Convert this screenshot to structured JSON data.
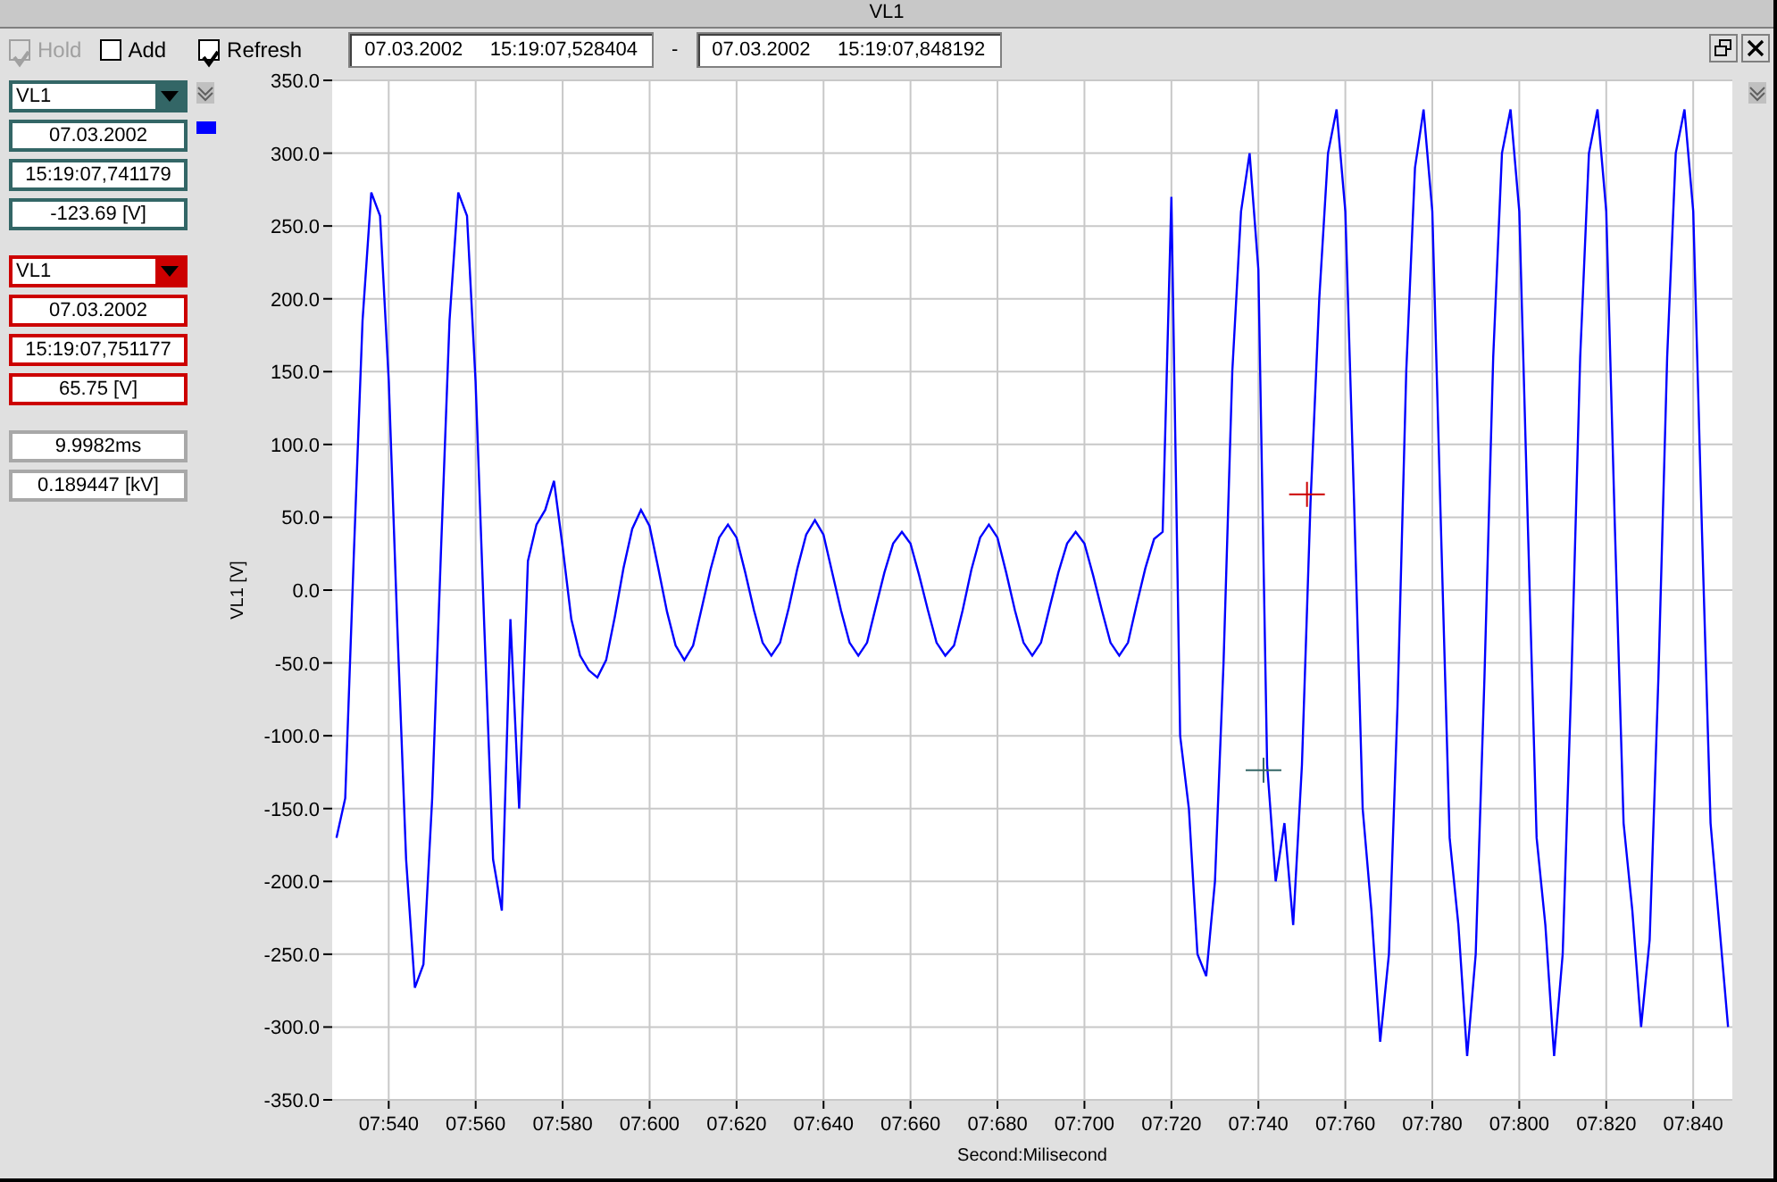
{
  "window": {
    "title": "VL1"
  },
  "toolbar": {
    "checkboxes": [
      {
        "label": "Hold",
        "checked": true,
        "disabled": true
      },
      {
        "label": "Add",
        "checked": false,
        "disabled": false
      },
      {
        "label": "Refresh",
        "checked": true,
        "disabled": false
      }
    ],
    "range_start": "07.03.2002     15:19:07,528404",
    "separator": "-",
    "range_end": "07.03.2002     15:19:07,848192"
  },
  "cursors": [
    {
      "channel": "VL1",
      "color": "#336666",
      "date": "07.03.2002",
      "time": "15:19:07,741179",
      "value": "-123.69 [V]"
    },
    {
      "channel": "VL1",
      "color": "#cc0000",
      "date": "07.03.2002",
      "time": "15:19:07,751177",
      "value": "65.75 [V]"
    }
  ],
  "delta": {
    "time": "9.9982ms",
    "value": "0.189447 [kV]"
  },
  "chart": {
    "chart_data": {
      "type": "line",
      "grid": true,
      "xlabel": "Second:Milisecond",
      "ylabel": "VL1 [V]",
      "ylim": [
        -350,
        350
      ],
      "categories": [
        null,
        null,
        null,
        null,
        null,
        null,
        "07:540",
        null,
        null,
        null,
        null,
        null,
        null,
        null,
        null,
        null,
        "07:560",
        null,
        null,
        null,
        null,
        null,
        null,
        null,
        null,
        null,
        "07:580",
        null,
        null,
        null,
        null,
        null,
        null,
        null,
        null,
        null,
        "07:600",
        null,
        null,
        null,
        null,
        null,
        null,
        null,
        null,
        null,
        "07:620",
        null,
        null,
        null,
        null,
        null,
        null,
        null,
        null,
        null,
        "07:640",
        null,
        null,
        null,
        null,
        null,
        null,
        null,
        null,
        null,
        "07:660",
        null,
        null,
        null,
        null,
        null,
        null,
        null,
        null,
        null,
        "07:680",
        null,
        null,
        null,
        null,
        null,
        null,
        null,
        null,
        null,
        "07:700",
        null,
        null,
        null,
        null,
        null,
        null,
        null,
        null,
        null,
        "07:720",
        null,
        null,
        null,
        null,
        null,
        null,
        null,
        null,
        null,
        "07:740",
        null,
        null,
        null,
        null,
        null,
        null,
        null,
        null,
        null,
        "07:760",
        null,
        null,
        null,
        null,
        null,
        null,
        null,
        null,
        null,
        "07:780",
        null,
        null,
        null,
        null,
        null,
        null,
        null,
        null,
        null,
        "07:800",
        null,
        null,
        null,
        null,
        null,
        null,
        null,
        null,
        null,
        "07:820",
        null,
        null,
        null,
        null,
        null,
        null,
        null,
        null,
        null,
        "07:840",
        null,
        null,
        null,
        null
      ],
      "yticks": [
        {
          "value": 350,
          "label": "350.0"
        },
        {
          "value": 300,
          "label": "300.0"
        },
        {
          "value": 250,
          "label": "250.0"
        },
        {
          "value": 200,
          "label": "200.0"
        },
        {
          "value": 150,
          "label": "150.0"
        },
        {
          "value": 100,
          "label": "100.0"
        },
        {
          "value": 50,
          "label": "50.0"
        },
        {
          "value": 0,
          "label": "0.0"
        },
        {
          "value": -50,
          "label": "-50.0"
        },
        {
          "value": -100,
          "label": "-100.0"
        },
        {
          "value": -150,
          "label": "-150.0"
        },
        {
          "value": -200,
          "label": "-200.0"
        },
        {
          "value": -250,
          "label": "-250.0"
        },
        {
          "value": -300,
          "label": "-300.0"
        },
        {
          "value": -350,
          "label": "-350.0"
        }
      ],
      "series": [
        {
          "color": "#0000ff",
          "values": [
            -170,
            -143,
            27,
            185,
            273,
            257,
            143,
            -26,
            -185,
            -273,
            -257,
            -143,
            26,
            185,
            273,
            257,
            143,
            -26,
            -185,
            -220,
            -20,
            -150,
            20,
            45,
            55,
            75,
            30,
            -20,
            -45,
            -55,
            -60,
            -48,
            -18,
            15,
            42,
            55,
            44,
            15,
            -15,
            -38,
            -48,
            -38,
            -12,
            14,
            36,
            45,
            36,
            12,
            -14,
            -36,
            -45,
            -36,
            -12,
            15,
            38,
            48,
            38,
            12,
            -14,
            -36,
            -45,
            -36,
            -12,
            12,
            32,
            40,
            32,
            10,
            -14,
            -36,
            -45,
            -38,
            -14,
            14,
            36,
            45,
            36,
            12,
            -14,
            -36,
            -45,
            -36,
            -12,
            12,
            32,
            40,
            32,
            10,
            -14,
            -36,
            -45,
            -36,
            -10,
            15,
            35,
            40,
            270,
            -100,
            -150,
            -250,
            -265,
            -200,
            -50,
            150,
            260,
            300,
            220,
            -120,
            -200,
            -160,
            -230,
            -120,
            60,
            200,
            300,
            330,
            260,
            60,
            -150,
            -220,
            -310,
            -250,
            -80,
            150,
            290,
            330,
            260,
            40,
            -170,
            -230,
            -320,
            -250,
            -60,
            160,
            300,
            330,
            260,
            40,
            -170,
            -230,
            -320,
            -250,
            -60,
            160,
            300,
            330,
            260,
            40,
            -160,
            -220,
            -300,
            -240,
            -60,
            160,
            300,
            330,
            260,
            40,
            -160,
            -230,
            -300
          ]
        }
      ]
    }
  }
}
